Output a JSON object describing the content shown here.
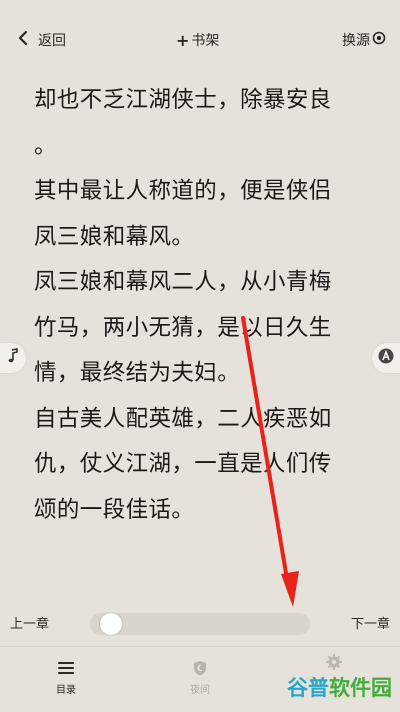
{
  "topbar": {
    "back_label": "返回",
    "add_shelf_label": "书架",
    "switch_source_label": "换源"
  },
  "content": {
    "lines": [
      "却也不乏江湖侠士，除暴安良",
      "。",
      "其中最让人称道的，便是侠侣",
      "凤三娘和幕风。",
      "凤三娘和幕风二人，从小青梅",
      "竹马，两小无猜，是以日久生",
      "情，最终结为夫妇。",
      "自古美人配英雄，二人疾恶如",
      "仇，仗义江湖，一直是人们传",
      "颂的一段佳话。"
    ]
  },
  "progress": {
    "prev_label": "上一章",
    "next_label": "下一章",
    "value_fraction": 0.05
  },
  "bottombar": {
    "toc_label": "目录",
    "night_label": "夜间"
  },
  "watermark": {
    "part_a": "谷普",
    "part_b": "软件园"
  },
  "colors": {
    "background": "#e7e1db",
    "arrow": "#e8231a",
    "watermark_blue": "#29a6c8",
    "watermark_green": "#3fae3a"
  }
}
